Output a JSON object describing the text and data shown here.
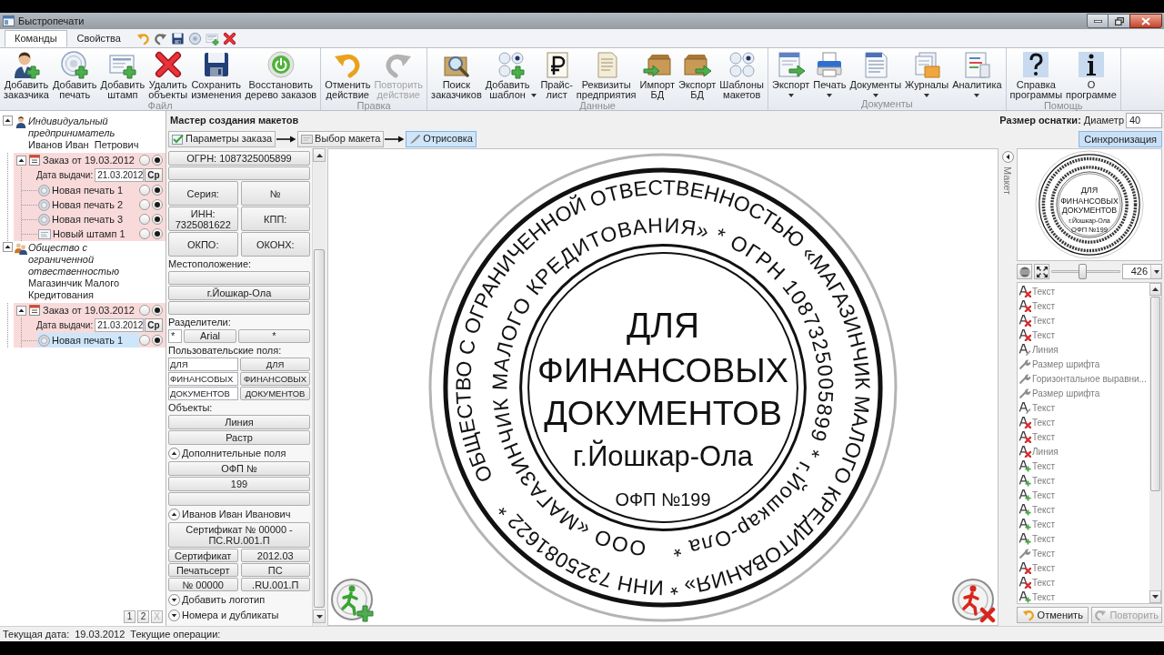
{
  "window": {
    "title": "Быстропечати"
  },
  "ribbon": {
    "tabs": [
      {
        "label": "Команды",
        "selected": true
      },
      {
        "label": "Свойства",
        "selected": false
      }
    ],
    "groups": [
      {
        "label": "Файл",
        "buttons": [
          {
            "label": "Добавить\nзаказчика",
            "disabled": false,
            "dropdown": false
          },
          {
            "label": "Добавить\nпечать",
            "disabled": false,
            "dropdown": false
          },
          {
            "label": "Добавить\nштамп",
            "disabled": false,
            "dropdown": false
          },
          {
            "label": "Удалить\nобъекты",
            "disabled": false,
            "dropdown": false
          },
          {
            "label": "Сохранить\nизменения",
            "disabled": false,
            "dropdown": false
          },
          {
            "label": "Восстановить\nдерево заказов",
            "disabled": false,
            "dropdown": false
          }
        ]
      },
      {
        "label": "Правка",
        "buttons": [
          {
            "label": "Отменить\nдействие",
            "disabled": false,
            "dropdown": false
          },
          {
            "label": "Повторить\nдействие",
            "disabled": true,
            "dropdown": false
          }
        ]
      },
      {
        "label": "Данные",
        "buttons": [
          {
            "label": "Поиск\nзаказчиков",
            "disabled": false,
            "dropdown": false
          },
          {
            "label": "Добавить\nшаблон",
            "disabled": false,
            "dropdown": true
          },
          {
            "label": "Прайс-\nлист",
            "disabled": false,
            "dropdown": false
          },
          {
            "label": "Реквизиты\nпредприятия",
            "disabled": false,
            "dropdown": false
          },
          {
            "label": "Импорт\nБД",
            "disabled": false,
            "dropdown": false
          },
          {
            "label": "Экспорт\nБД",
            "disabled": false,
            "dropdown": false
          },
          {
            "label": "Шаблоны\nмакетов",
            "disabled": false,
            "dropdown": false
          }
        ]
      },
      {
        "label": "Документы",
        "buttons": [
          {
            "label": "Экспорт",
            "disabled": false,
            "dropdown": true
          },
          {
            "label": "Печать",
            "disabled": false,
            "dropdown": true
          },
          {
            "label": "Документы",
            "disabled": false,
            "dropdown": true
          },
          {
            "label": "Журналы",
            "disabled": false,
            "dropdown": true
          },
          {
            "label": "Аналитика",
            "disabled": false,
            "dropdown": true
          }
        ]
      },
      {
        "label": "Помощь",
        "buttons": [
          {
            "label": "Справка\nпрограммы",
            "disabled": false,
            "dropdown": false
          },
          {
            "label": "О\nпрограмме",
            "disabled": false,
            "dropdown": false
          }
        ]
      }
    ]
  },
  "tree": {
    "customers": [
      {
        "kind": "person",
        "type": "Индивидуальный предприниматель",
        "name": "Иванов Иван  Петрович",
        "expanded": true,
        "children": [
          {
            "title": "Заказ от 19.03.2012",
            "expanded": true,
            "options": [
              {
                "selected": false
              },
              {
                "selected": true
              }
            ],
            "date_label": "Дата выдачи:",
            "date": "21.03.2012",
            "weekday": "Ср",
            "children": [
              {
                "kind": "seal",
                "label": "Новая печать 1",
                "selected": false,
                "options": [
                  {
                    "selected": false
                  },
                  {
                    "selected": true
                  }
                ]
              },
              {
                "kind": "seal",
                "label": "Новая печать 2",
                "selected": false,
                "options": [
                  {
                    "selected": false
                  },
                  {
                    "selected": true
                  }
                ]
              },
              {
                "kind": "seal",
                "label": "Новая печать 3",
                "selected": false,
                "options": [
                  {
                    "selected": false
                  },
                  {
                    "selected": true
                  }
                ]
              },
              {
                "kind": "stamp",
                "label": "Новый штамп 1",
                "selected": false,
                "options": [
                  {
                    "selected": false
                  },
                  {
                    "selected": true
                  }
                ]
              }
            ]
          }
        ]
      },
      {
        "kind": "company",
        "type": "Общество с ограниченной отвественностью",
        "name": "Магазинчик Малого Кредитования",
        "expanded": true,
        "children": [
          {
            "title": "Заказ от 19.03.2012",
            "expanded": true,
            "options": [
              {
                "selected": false
              },
              {
                "selected": true
              }
            ],
            "date_label": "Дата выдачи:",
            "date": "21.03.2012",
            "weekday": "Ср",
            "children": [
              {
                "kind": "seal",
                "label": "Новая печать 1",
                "selected": true,
                "options": [
                  {
                    "selected": false
                  },
                  {
                    "selected": true
                  }
                ]
              }
            ]
          }
        ]
      }
    ],
    "pager": [
      {
        "label": "1",
        "disabled": false
      },
      {
        "label": "2",
        "disabled": false
      },
      {
        "label": "X",
        "disabled": true
      }
    ]
  },
  "wizard": {
    "title": "Мастер создания макетов",
    "size_label": "Размер оснатки:",
    "diameter_label": "Диаметр",
    "diameter": "40",
    "steps": [
      {
        "label": "Параметры заказа",
        "selected": false
      },
      {
        "label": "Выбор макета",
        "selected": false
      },
      {
        "label": "Отрисовка",
        "selected": true
      }
    ],
    "sync_button": {
      "label": "Синхронизация",
      "active": true
    }
  },
  "form": {
    "rows": [
      {
        "kind": "button",
        "text": "ОГРН: 1087325005899"
      },
      {
        "kind": "blank"
      },
      {
        "kind": "tallpair",
        "cells": [
          "Серия:",
          "№"
        ]
      },
      {
        "kind": "tallpair",
        "cells": [
          "ИНН:\n7325081622",
          "КПП:"
        ]
      },
      {
        "kind": "tallpair",
        "cells": [
          "ОКПО:",
          "ОКОНХ:"
        ]
      },
      {
        "kind": "label",
        "text": "Местоположение:"
      },
      {
        "kind": "blank"
      },
      {
        "kind": "button",
        "text": "г.Йошкар-Ола"
      },
      {
        "kind": "blank"
      },
      {
        "kind": "label",
        "text": "Разделители:"
      },
      {
        "kind": "separators",
        "cells": [
          "*",
          "Arial",
          "*"
        ]
      },
      {
        "kind": "label",
        "text": "Пользовательские поля:"
      },
      {
        "kind": "fieldpair",
        "cells": [
          "ДЛЯ",
          "ДЛЯ"
        ]
      },
      {
        "kind": "fieldpair",
        "cells": [
          "ФИНАНСОВЫХ",
          "ФИНАНСОВЫХ"
        ]
      },
      {
        "kind": "fieldpair",
        "cells": [
          "ДОКУМЕНТОВ",
          "ДОКУМЕНТОВ"
        ]
      },
      {
        "kind": "label",
        "text": "Объекты:"
      },
      {
        "kind": "button",
        "text": "Линия"
      },
      {
        "kind": "button",
        "text": "Растр"
      },
      {
        "kind": "section",
        "text": "Дополнительные поля",
        "expanded": true
      },
      {
        "kind": "button",
        "text": "ОФП №"
      },
      {
        "kind": "button",
        "text": "199"
      },
      {
        "kind": "blank"
      },
      {
        "kind": "section",
        "text": "Иванов Иван Иванович",
        "expanded": true
      },
      {
        "kind": "button",
        "text": "Сертификат № 00000 -\nПС.RU.001.П"
      },
      {
        "kind": "pair",
        "cells": [
          "Сертификат",
          "2012.03"
        ]
      },
      {
        "kind": "pair",
        "cells": [
          "Печатьсерт",
          "ПС"
        ]
      },
      {
        "kind": "pair",
        "cells": [
          "№ 00000",
          ".RU.001.П"
        ]
      },
      {
        "kind": "section",
        "text": "Добавить логотип",
        "expanded": false
      },
      {
        "kind": "section",
        "text": "Номера и дубликаты",
        "expanded": false
      }
    ]
  },
  "stamp": {
    "outer_ring": "ОБЩЕСТВО С ОГРАНИЧЕННОЙ ОТВЕСТВЕННОСТЬЮ «МАГАЗИНЧИК МАЛОГО КРЕДИТОВАНИЯ» * ИНН 7325081622 *",
    "inner_ring": "ООО «МАГАЗИНЧИК МАЛОГО КРЕДИТОВАНИЯ» * ОГРН 1087325005899 * г.Йошкар-Ола *",
    "lines": [
      "ДЛЯ",
      "ФИНАНСОВЫХ",
      "ДОКУМЕНТОВ",
      "г.Йошкар-Ола",
      "ОФП №199"
    ]
  },
  "side_tab": {
    "label": "Макет",
    "expanded": false
  },
  "preview": {
    "lines": [
      "ДЛЯ",
      "ФИНАНСОВЫХ",
      "ДОКУМЕНТОВ",
      "г.Йошкар-Ола",
      "ОФП №199"
    ]
  },
  "zoom": {
    "level": 0.45,
    "value": "426"
  },
  "history": {
    "items": [
      {
        "kind": "removed",
        "label": "Текст"
      },
      {
        "kind": "removed",
        "label": "Текст"
      },
      {
        "kind": "removed",
        "label": "Текст"
      },
      {
        "kind": "removed",
        "label": "Текст"
      },
      {
        "kind": "changed",
        "label": "Линия"
      },
      {
        "kind": "property",
        "label": "Размер шрифта"
      },
      {
        "kind": "property",
        "label": "Горизонтальное выравни..."
      },
      {
        "kind": "property",
        "label": "Размер шрифта"
      },
      {
        "kind": "changed",
        "label": "Текст"
      },
      {
        "kind": "removed",
        "label": "Текст"
      },
      {
        "kind": "removed",
        "label": "Текст"
      },
      {
        "kind": "removed",
        "label": "Линия"
      },
      {
        "kind": "added",
        "label": "Текст"
      },
      {
        "kind": "added",
        "label": "Текст"
      },
      {
        "kind": "added",
        "label": "Текст"
      },
      {
        "kind": "added",
        "label": "Текст"
      },
      {
        "kind": "added",
        "label": "Текст"
      },
      {
        "kind": "added",
        "label": "Текст"
      },
      {
        "kind": "property",
        "label": "Текст"
      },
      {
        "kind": "removed",
        "label": "Текст"
      },
      {
        "kind": "removed",
        "label": "Текст"
      },
      {
        "kind": "added",
        "label": "Текст"
      }
    ]
  },
  "history_buttons": [
    {
      "label": "Отменить",
      "disabled": false
    },
    {
      "label": "Повторить",
      "disabled": true
    }
  ],
  "status_bar": {
    "date_label": "Текущая дата:",
    "date": "19.03.2012",
    "operations_label": "Текущие операции:"
  }
}
